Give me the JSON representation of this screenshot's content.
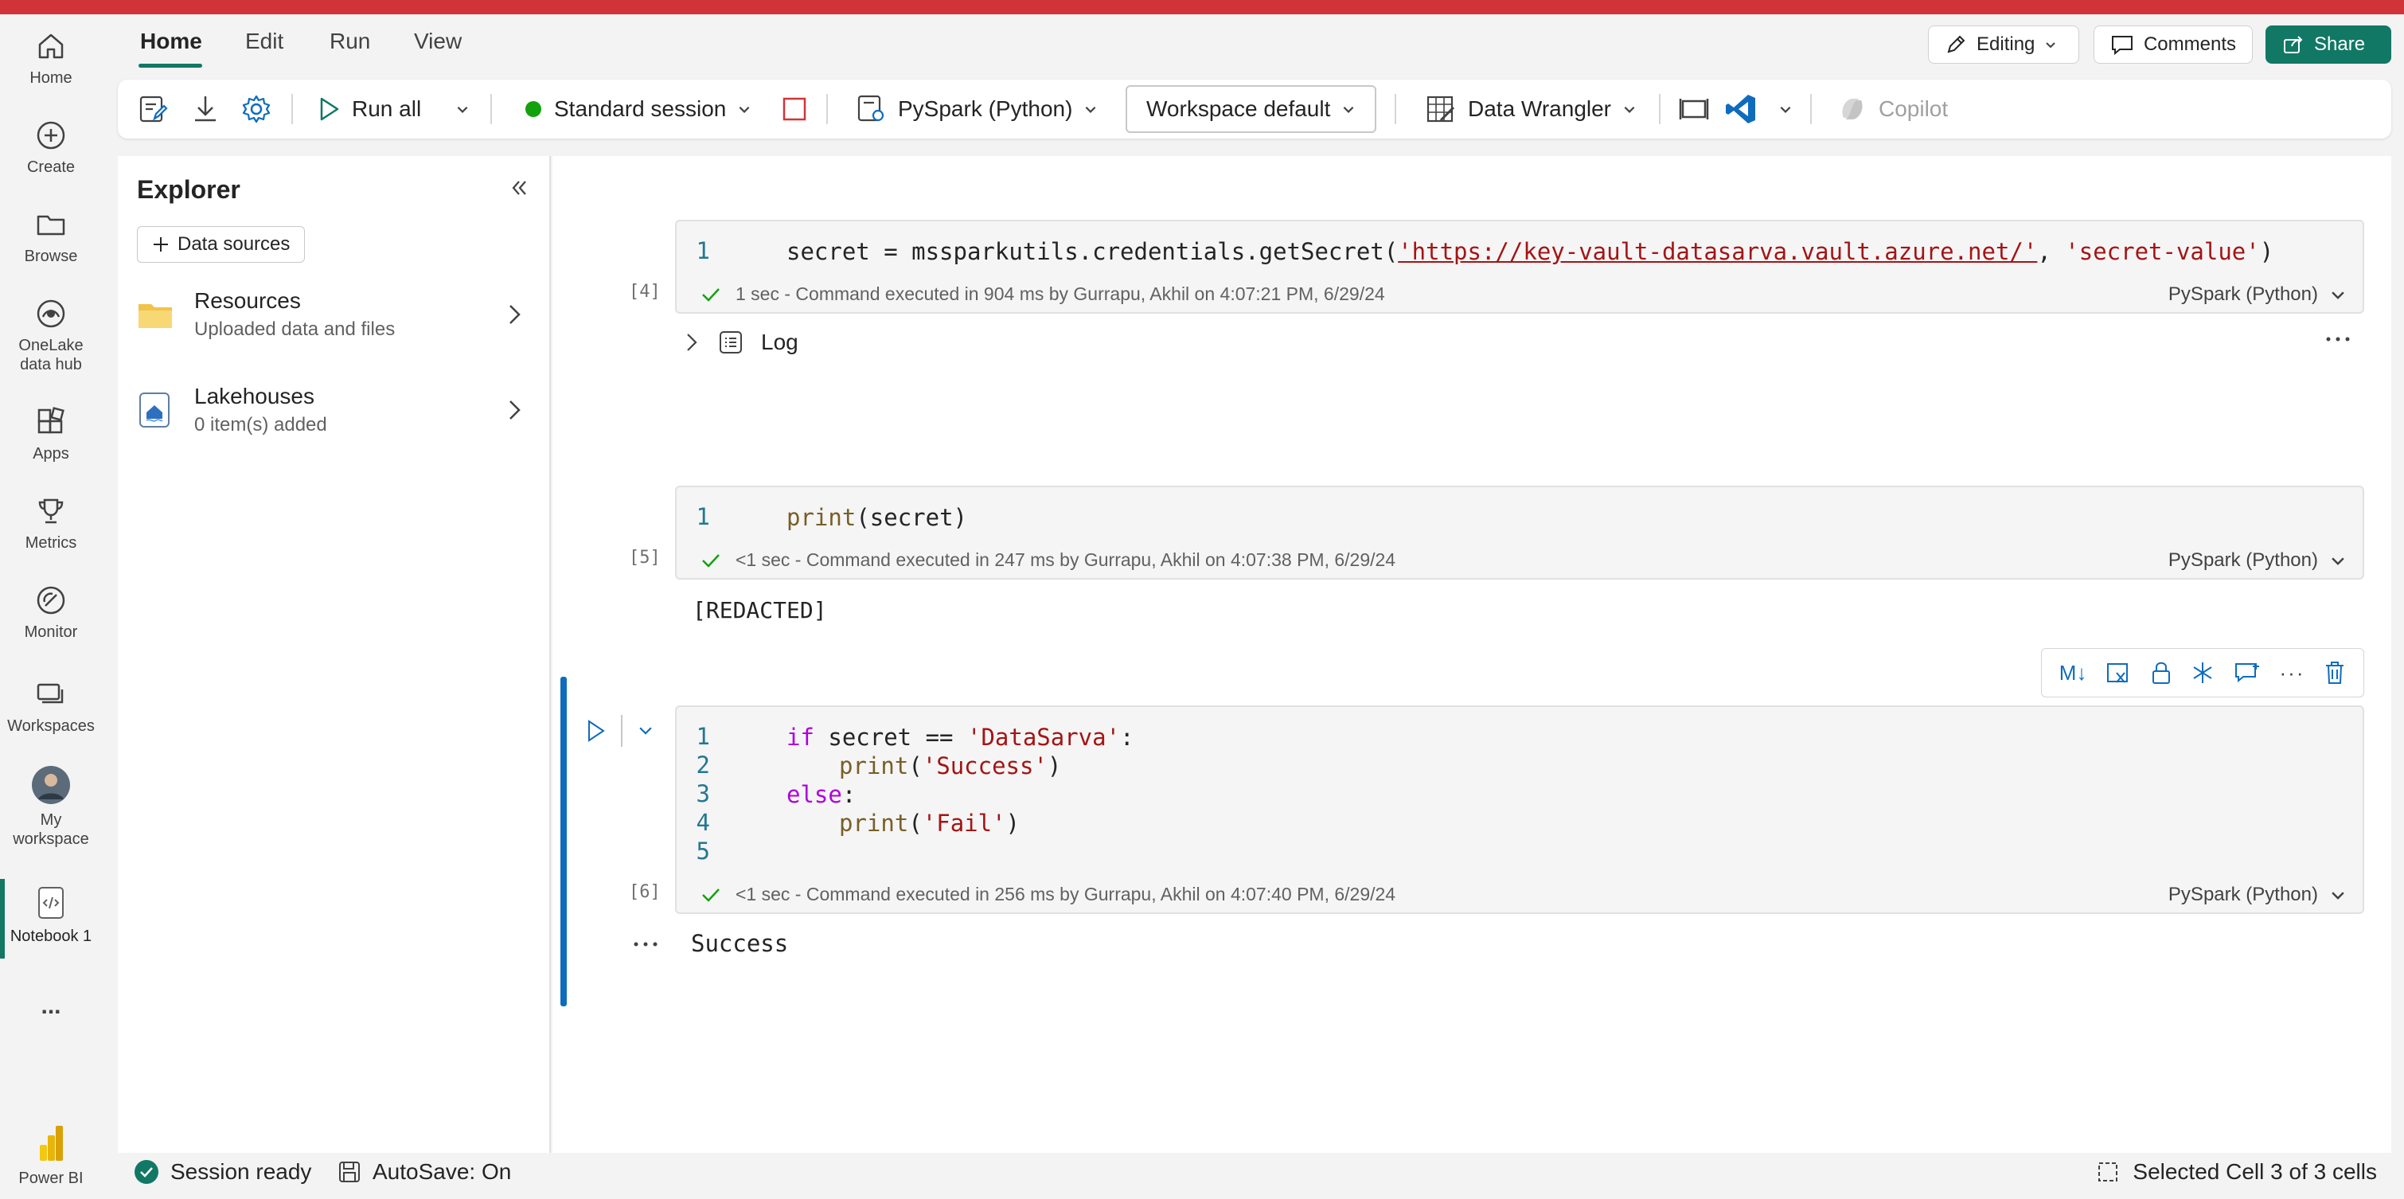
{
  "colors": {
    "brand": "#117865",
    "topstrip": "#d13438",
    "accent_blue": "#0f6cbd"
  },
  "nav": {
    "items": [
      {
        "label": "Home",
        "icon": "home-icon"
      },
      {
        "label": "Create",
        "icon": "plus-circle-icon"
      },
      {
        "label": "Browse",
        "icon": "folder-icon"
      },
      {
        "label": "OneLake",
        "label2": "data hub",
        "icon": "onelake-icon"
      },
      {
        "label": "Apps",
        "icon": "apps-icon"
      },
      {
        "label": "Metrics",
        "icon": "trophy-icon"
      },
      {
        "label": "Monitor",
        "icon": "monitor-icon"
      },
      {
        "label": "Workspaces",
        "icon": "workspaces-icon"
      },
      {
        "label": "My",
        "label2": "workspace",
        "icon": "avatar-icon"
      },
      {
        "label": "Notebook 1",
        "icon": "notebook-icon"
      },
      {
        "label": "...",
        "icon": "more-icon"
      },
      {
        "label": "Power BI",
        "icon": "powerbi-icon"
      }
    ]
  },
  "tabs": [
    "Home",
    "Edit",
    "Run",
    "View"
  ],
  "header": {
    "editing": "Editing",
    "comments": "Comments",
    "share": "Share"
  },
  "ribbon": {
    "run_all": "Run all",
    "session": "Standard session",
    "language": "PySpark (Python)",
    "environment": "Workspace default",
    "data_wrangler": "Data Wrangler",
    "copilot": "Copilot"
  },
  "explorer": {
    "title": "Explorer",
    "data_sources": "Data sources",
    "items": [
      {
        "title": "Resources",
        "subtitle": "Uploaded data and files"
      },
      {
        "title": "Lakehouses",
        "subtitle": "0 item(s) added"
      }
    ]
  },
  "cells": [
    {
      "exec": "[4]",
      "line_numbers": [
        "1"
      ],
      "code_parts": {
        "a": "secret = mssparkutils.credentials.getSecret(",
        "url": "'https://key-vault-datasarva.vault.azure.net/'",
        "b": ", ",
        "c": "'secret-value'",
        "d": ")"
      },
      "status": "1 sec - Command executed in 904 ms by Gurrapu, Akhil on 4:07:21 PM, 6/29/24",
      "lang": "PySpark (Python)",
      "log_label": "Log"
    },
    {
      "exec": "[5]",
      "line_numbers": [
        "1"
      ],
      "code_parts": {
        "fn": "print",
        "rest": "(secret)"
      },
      "status": "<1 sec - Command executed in 247 ms by Gurrapu, Akhil on 4:07:38 PM, 6/29/24",
      "lang": "PySpark (Python)",
      "output": "[REDACTED]"
    },
    {
      "exec": "[6]",
      "line_numbers": [
        "1",
        "2",
        "3",
        "4",
        "5"
      ],
      "code_parts": {
        "if": "if",
        "cond": " secret == ",
        "cond_str": "'DataSarva'",
        "colon": ":",
        "print1": "print",
        "s1": "'Success'",
        "else": "else",
        "print2": "print",
        "s2": "'Fail'",
        "open": "(",
        "close": ")"
      },
      "status": "<1 sec - Command executed in 256 ms by Gurrapu, Akhil on 4:07:40 PM, 6/29/24",
      "lang": "PySpark (Python)",
      "output": "Success",
      "toolbar": {
        "md": "M↓",
        "more": "···"
      }
    }
  ],
  "statusbar": {
    "session": "Session ready",
    "autosave": "AutoSave: On",
    "selected": "Selected Cell 3 of 3 cells"
  }
}
